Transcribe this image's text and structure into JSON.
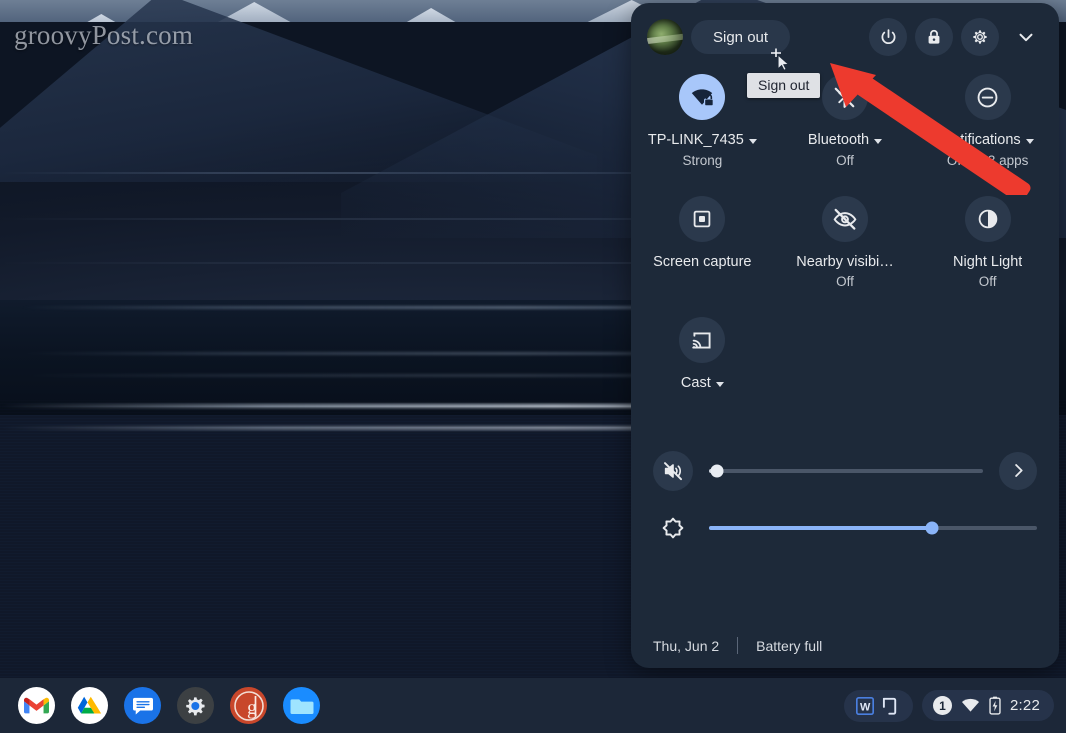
{
  "watermark": "groovyPost.com",
  "quick_settings": {
    "sign_out_label": "Sign out",
    "tooltip": "Sign out",
    "top_icons": [
      {
        "name": "power-button",
        "label": "Power"
      },
      {
        "name": "lock-button",
        "label": "Lock"
      },
      {
        "name": "settings-button",
        "label": "Settings"
      },
      {
        "name": "collapse-button",
        "label": "Collapse"
      }
    ],
    "tiles": [
      {
        "label": "TP-LINK_7435",
        "sub": "Strong",
        "icon": "wifi-icon",
        "state": "on",
        "caret": true
      },
      {
        "label": "Bluetooth",
        "sub": "Off",
        "icon": "bluetooth-disabled-icon",
        "state": "off",
        "caret": true
      },
      {
        "label": "Notifications",
        "sub": "Off for 3 apps",
        "icon": "do-not-disturb-icon",
        "state": "off",
        "caret": true
      },
      {
        "label": "Screen capture",
        "sub": "",
        "icon": "screen-capture-icon",
        "state": "off",
        "caret": false
      },
      {
        "label": "Nearby visibi…",
        "sub": "Off",
        "icon": "nearby-visibility-off-icon",
        "state": "off",
        "caret": false
      },
      {
        "label": "Night Light",
        "sub": "Off",
        "icon": "night-light-icon",
        "state": "off",
        "caret": false
      },
      {
        "label": "Cast",
        "sub": "",
        "icon": "cast-icon",
        "state": "off",
        "caret": true
      }
    ],
    "volume": {
      "icon": "volume-muted-icon",
      "value": 3,
      "chevron": "chevron-right-icon"
    },
    "brightness": {
      "icon": "brightness-icon",
      "value": 68
    },
    "footer": {
      "date": "Thu, Jun 2",
      "battery": "Battery full"
    }
  },
  "shelf": {
    "apps": [
      {
        "name": "gmail",
        "label": "Gmail"
      },
      {
        "name": "google-drive",
        "label": "Google Drive"
      },
      {
        "name": "messages",
        "label": "Messages"
      },
      {
        "name": "settings",
        "label": "Settings"
      },
      {
        "name": "groovypost",
        "label": "groovyPost"
      },
      {
        "name": "files",
        "label": "Files"
      }
    ],
    "window_group": [
      {
        "name": "word-icon",
        "label": "W"
      },
      {
        "name": "window-icon",
        "label": "Window"
      }
    ],
    "tray": {
      "notification_count": "1",
      "network_icon": "wifi-icon",
      "battery_icon": "battery-charging-icon",
      "time": "2:22"
    }
  },
  "annotation": {
    "type": "red-arrow",
    "points_at": "power-button",
    "color": "#ed3a2e"
  },
  "colors": {
    "panel_bg": "#1d2939",
    "tile_bg": "#2b394c",
    "tile_active_bg": "#a8c7fa",
    "accent": "#8ab4f8",
    "shelf_bg": "#1c2738",
    "text": "#e8eaed",
    "text_secondary": "#c3c8cf"
  }
}
